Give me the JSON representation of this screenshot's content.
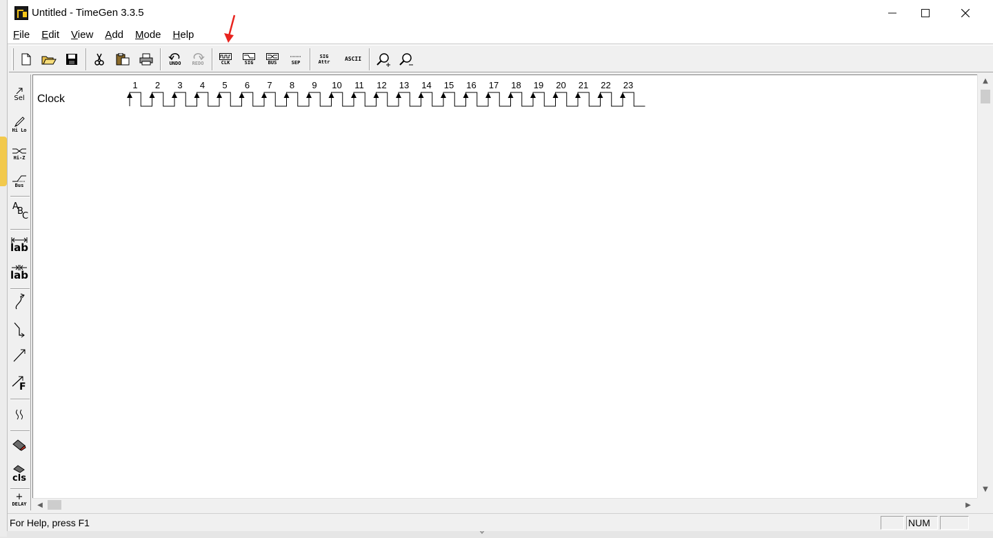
{
  "window": {
    "title": "Untitled - TimeGen 3.3.5"
  },
  "window_controls": {
    "minimize": "—",
    "maximize": "☐",
    "close": "✕"
  },
  "menu": [
    {
      "accel": "F",
      "rest": "ile"
    },
    {
      "accel": "E",
      "rest": "dit"
    },
    {
      "accel": "V",
      "rest": "iew"
    },
    {
      "accel": "A",
      "rest": "dd"
    },
    {
      "accel": "M",
      "rest": "ode"
    },
    {
      "accel": "H",
      "rest": "elp"
    }
  ],
  "toolbar": {
    "undo_label": "UNDO",
    "redo_label": "REDO",
    "clk_label": "CLK",
    "sig_label": "SIG",
    "bus_label": "BUS",
    "sep_label": "SEP",
    "sig_attr_top": "SIG",
    "sig_attr_bottom": "Attr",
    "ascii_label": "ASCII"
  },
  "palette": {
    "sel": "Sel",
    "hilo": "Hi Lo",
    "hiz": "Hi-Z",
    "bus": "Bus",
    "abc_a": "A",
    "abc_b": "B",
    "abc_c": "C",
    "lab1": "lab",
    "lab2": "lab",
    "f_label": "F",
    "cls": "cls",
    "delay": "DELAY"
  },
  "diagram": {
    "signal_name": "Clock",
    "cycle_count": 23,
    "cycles": [
      "1",
      "2",
      "3",
      "4",
      "5",
      "6",
      "7",
      "8",
      "9",
      "10",
      "11",
      "12",
      "13",
      "14",
      "15",
      "16",
      "17",
      "18",
      "19",
      "20",
      "21",
      "22",
      "23"
    ]
  },
  "status": {
    "help_text": "For Help, press F1",
    "num": "NUM"
  },
  "colors": {
    "annotation_arrow": "#e8241f",
    "canvas": "#ffffff",
    "chrome": "#f0f0f0"
  }
}
